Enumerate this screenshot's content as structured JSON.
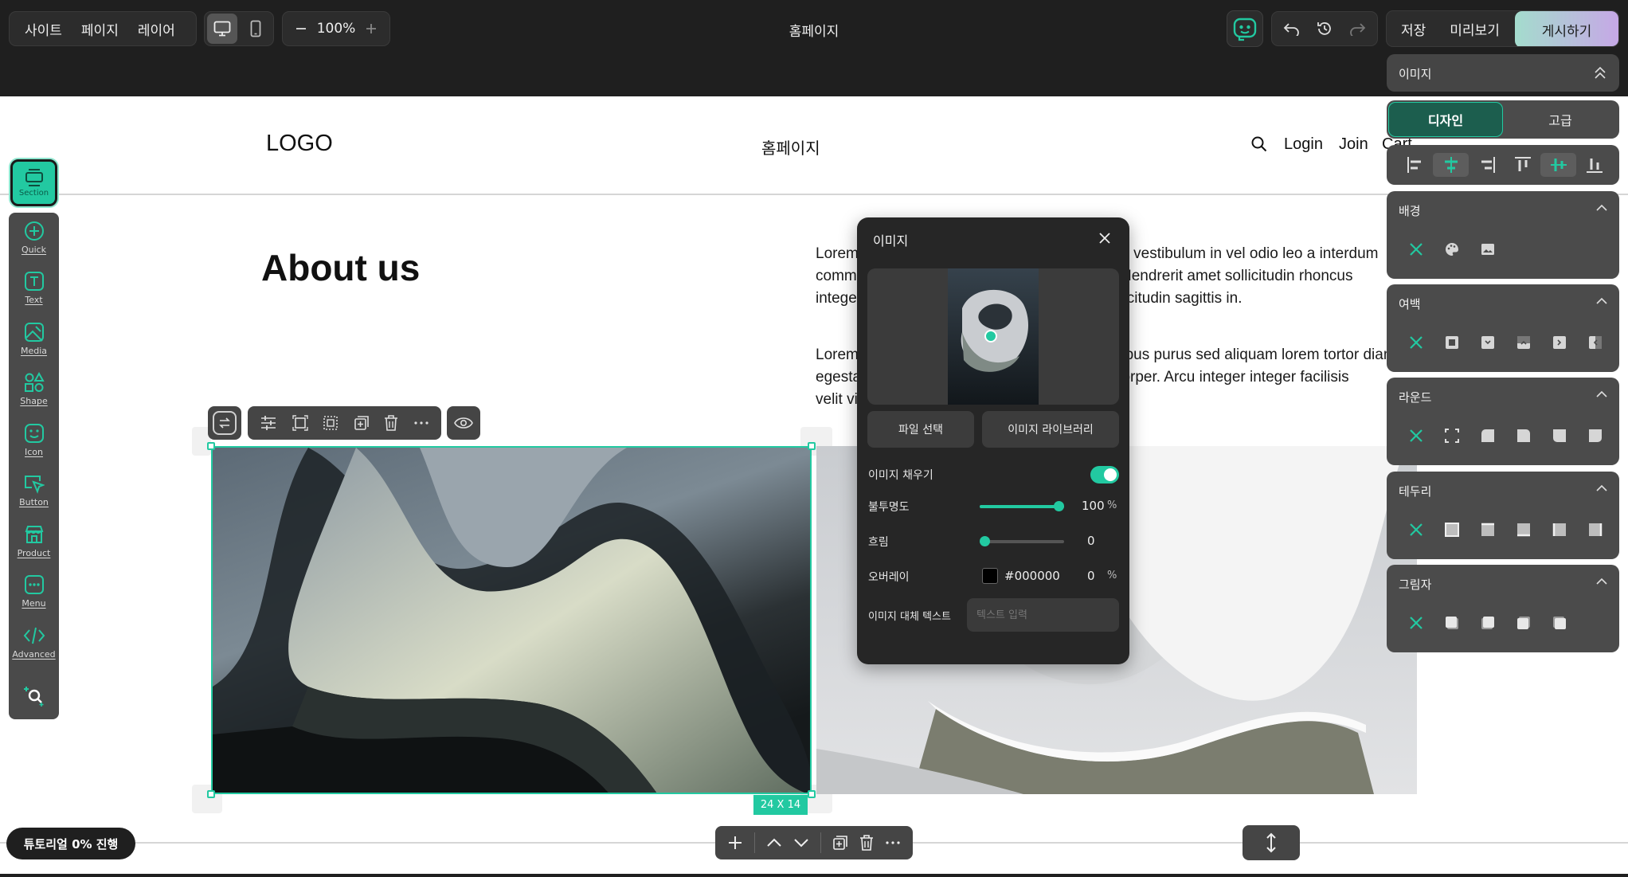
{
  "topbar": {
    "menu": [
      "사이트",
      "페이지",
      "레이어"
    ],
    "zoom": "100%",
    "page_title": "홈페이지",
    "save_label": "저장",
    "preview_label": "미리보기",
    "publish_label": "게시하기"
  },
  "left_toolbar": {
    "section_label": "Section",
    "tools": [
      "Quick",
      "Text",
      "Media",
      "Shape",
      "Icon",
      "Button",
      "Product",
      "Menu",
      "Advanced"
    ]
  },
  "canvas": {
    "logo": "LOGO",
    "nav_center": "홈페이지",
    "nav_login": "Login",
    "nav_join": "Join",
    "nav_cart": "Cart",
    "about_title": "About us",
    "para1": [
      "Lorem ipsum dolor sit amet consectetur. Metus vestibulum in vel odio leo a interdum",
      "commodo. Tempus duis fringilla eget sagittis. Hendrerit amet sollicitudin rhoncus",
      "integer. Pulvinar est ut et pellentesque leo sollicitudin sagittis in."
    ],
    "para2": [
      "Lorem ipsum dolor sit amet consectetur. Faucibus purus sed aliquam lorem tortor diam",
      "egestas. Volutpat nunc a lectus in nibh ullamcorper. Arcu integer integer facilisis",
      "velit viverra."
    ],
    "size_badge": "24 X 14",
    "tutorial_badge": "튜토리얼 0% 진행"
  },
  "image_popup": {
    "title": "이미지",
    "file_select": "파일 선택",
    "image_library": "이미지 라이브러리",
    "fill_label": "이미지 채우기",
    "fill_on": true,
    "opacity_label": "불투명도",
    "opacity_value": "100",
    "opacity_unit": "%",
    "opacity_level": 1.0,
    "blur_label": "흐림",
    "blur_value": "0",
    "blur_level": 0.0,
    "overlay_label": "오버레이",
    "overlay_color": "#000000",
    "overlay_value": "0",
    "overlay_unit": "%",
    "alt_label": "이미지 대체 텍스트",
    "alt_placeholder": "텍스트 입력"
  },
  "right_panel": {
    "element_label": "이미지",
    "tab_design": "디자인",
    "tab_advanced": "고급",
    "sections": [
      {
        "title": "배경"
      },
      {
        "title": "여백"
      },
      {
        "title": "라운드"
      },
      {
        "title": "테두리"
      },
      {
        "title": "그림자"
      }
    ]
  },
  "colors": {
    "accent": "#22c9a1",
    "topbar_bg": "#1f1f1f",
    "panel_bg": "#4b4b4b",
    "publish_gradient": [
      "#9fd8c9",
      "#c9a9e8"
    ]
  },
  "icons": {
    "alignment": [
      "align-left-icon",
      "align-center-h-icon",
      "align-right-icon",
      "align-top-icon",
      "align-center-v-icon",
      "align-bottom-icon"
    ],
    "element_toolbar": [
      "swap-icon",
      "settings-sliders-icon",
      "frame-icon",
      "crop-icon",
      "duplicate-icon",
      "trash-icon",
      "more-icon",
      "eye-icon"
    ],
    "bottom_toolbar": [
      "plus-icon",
      "chevron-up-icon",
      "chevron-down-icon",
      "duplicate-icon",
      "trash-icon",
      "more-icon"
    ]
  }
}
